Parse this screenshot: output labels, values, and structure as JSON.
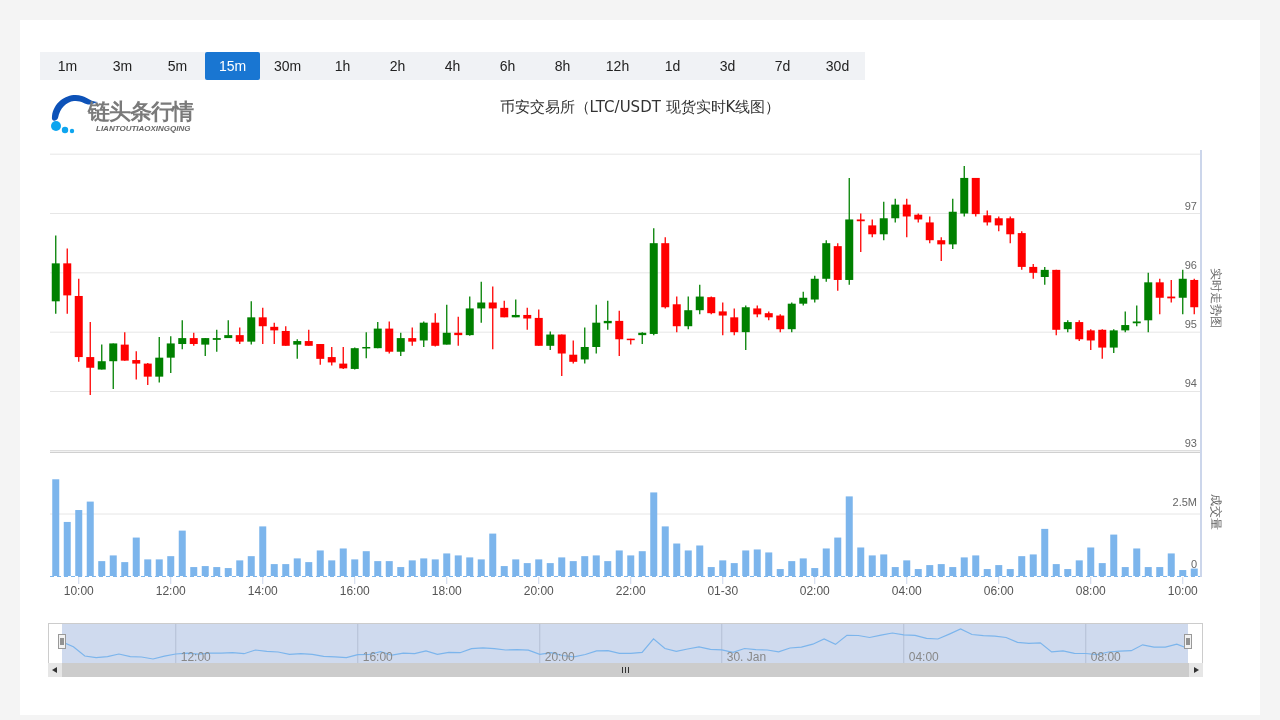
{
  "timeframes": [
    {
      "label": "1m",
      "selected": false
    },
    {
      "label": "3m",
      "selected": false
    },
    {
      "label": "5m",
      "selected": false
    },
    {
      "label": "15m",
      "selected": true
    },
    {
      "label": "30m",
      "selected": false
    },
    {
      "label": "1h",
      "selected": false
    },
    {
      "label": "2h",
      "selected": false
    },
    {
      "label": "4h",
      "selected": false
    },
    {
      "label": "6h",
      "selected": false
    },
    {
      "label": "8h",
      "selected": false
    },
    {
      "label": "12h",
      "selected": false
    },
    {
      "label": "1d",
      "selected": false
    },
    {
      "label": "3d",
      "selected": false
    },
    {
      "label": "7d",
      "selected": false
    },
    {
      "label": "30d",
      "selected": false
    }
  ],
  "logo": {
    "name": "链头条行情",
    "subtitle": "LIANTOUTIAOXINGQING"
  },
  "title": "币安交易所（LTC/USDT 现货实时K线图）",
  "price_panel": {
    "chart_data": {
      "type": "candlestick",
      "ylabel": "实时走势图",
      "ylim": [
        93,
        98
      ],
      "yticks": [
        93,
        94,
        95,
        96,
        97
      ],
      "grid": true,
      "categories": [
        null,
        null,
        null,
        null,
        null,
        null,
        null,
        null,
        null,
        null,
        null,
        null,
        null,
        null,
        null,
        null,
        null,
        null,
        null,
        null,
        null,
        null,
        null,
        null,
        null,
        null,
        null,
        null,
        null,
        null,
        null,
        null,
        null,
        null,
        null,
        null,
        null,
        null,
        null,
        null,
        null,
        null,
        null,
        null,
        null,
        null,
        null,
        null,
        null,
        null,
        null,
        null,
        null,
        null,
        null,
        null,
        null,
        null,
        null,
        null,
        null,
        null,
        null,
        null,
        null,
        null,
        null,
        null,
        null,
        null,
        null,
        null,
        null,
        null,
        null,
        null,
        null,
        null,
        null,
        null,
        null,
        null,
        null,
        null,
        null,
        null,
        null,
        null,
        null,
        null,
        null,
        null,
        null,
        null,
        null,
        null,
        null,
        null,
        null,
        null
      ],
      "ohlc": [
        [
          95.52,
          96.63,
          95.31,
          96.16
        ],
        [
          96.16,
          96.41,
          95.31,
          95.62
        ],
        [
          95.61,
          95.9,
          94.5,
          94.58
        ],
        [
          94.58,
          95.17,
          93.94,
          94.4
        ],
        [
          94.37,
          94.79,
          94.37,
          94.51
        ],
        [
          94.51,
          94.81,
          94.04,
          94.81
        ],
        [
          94.79,
          95.0,
          94.52,
          94.52
        ],
        [
          94.53,
          94.68,
          94.2,
          94.47
        ],
        [
          94.47,
          94.48,
          94.11,
          94.25
        ],
        [
          94.25,
          94.92,
          94.15,
          94.57
        ],
        [
          94.57,
          94.93,
          94.31,
          94.81
        ],
        [
          94.8,
          95.2,
          94.71,
          94.9
        ],
        [
          94.9,
          94.99,
          94.77,
          94.8
        ],
        [
          94.79,
          94.9,
          94.6,
          94.9
        ],
        [
          94.87,
          95.04,
          94.67,
          94.9
        ],
        [
          94.9,
          95.2,
          94.9,
          94.95
        ],
        [
          94.95,
          95.08,
          94.8,
          94.84
        ],
        [
          94.84,
          95.52,
          94.79,
          95.25
        ],
        [
          95.25,
          95.41,
          94.8,
          95.1
        ],
        [
          95.09,
          95.16,
          94.8,
          95.03
        ],
        [
          95.02,
          95.1,
          94.77,
          94.77
        ],
        [
          94.79,
          94.88,
          94.55,
          94.85
        ],
        [
          94.85,
          95.04,
          94.77,
          94.77
        ],
        [
          94.8,
          94.8,
          94.45,
          94.55
        ],
        [
          94.58,
          94.75,
          94.44,
          94.49
        ],
        [
          94.47,
          94.75,
          94.38,
          94.39
        ],
        [
          94.38,
          94.74,
          94.37,
          94.73
        ],
        [
          94.73,
          95.0,
          94.56,
          94.75
        ],
        [
          94.73,
          95.17,
          94.73,
          95.06
        ],
        [
          95.06,
          95.18,
          94.64,
          94.67
        ],
        [
          94.67,
          94.99,
          94.6,
          94.9
        ],
        [
          94.9,
          95.08,
          94.77,
          94.84
        ],
        [
          94.86,
          95.18,
          94.75,
          95.16
        ],
        [
          95.16,
          95.32,
          94.76,
          94.77
        ],
        [
          94.79,
          95.46,
          94.79,
          94.99
        ],
        [
          94.99,
          95.26,
          94.77,
          94.95
        ],
        [
          94.95,
          95.6,
          94.94,
          95.4
        ],
        [
          95.4,
          95.85,
          95.16,
          95.5
        ],
        [
          95.5,
          95.77,
          94.71,
          95.4
        ],
        [
          95.41,
          95.53,
          95.25,
          95.25
        ],
        [
          95.25,
          95.55,
          95.25,
          95.29
        ],
        [
          95.29,
          95.41,
          95.04,
          95.23
        ],
        [
          95.24,
          95.38,
          94.77,
          94.77
        ],
        [
          94.77,
          95.01,
          94.7,
          94.96
        ],
        [
          94.96,
          94.96,
          94.26,
          94.64
        ],
        [
          94.62,
          94.86,
          94.47,
          94.5
        ],
        [
          94.54,
          95.08,
          94.47,
          94.75
        ],
        [
          94.75,
          95.46,
          94.64,
          95.16
        ],
        [
          95.15,
          95.53,
          95.04,
          95.19
        ],
        [
          95.19,
          95.36,
          94.6,
          94.88
        ],
        [
          94.89,
          94.89,
          94.79,
          94.88
        ],
        [
          94.95,
          95.0,
          94.8,
          94.99
        ],
        [
          94.97,
          96.75,
          94.95,
          96.5
        ],
        [
          96.5,
          96.6,
          95.4,
          95.42
        ],
        [
          95.47,
          95.6,
          95.0,
          95.1
        ],
        [
          95.1,
          95.6,
          95.05,
          95.37
        ],
        [
          95.37,
          95.8,
          95.3,
          95.6
        ],
        [
          95.59,
          95.6,
          95.3,
          95.32
        ],
        [
          95.35,
          95.5,
          94.95,
          95.28
        ],
        [
          95.25,
          95.4,
          94.95,
          95.0
        ],
        [
          95.0,
          95.45,
          94.7,
          95.42
        ],
        [
          95.4,
          95.45,
          95.25,
          95.3
        ],
        [
          95.32,
          95.35,
          95.2,
          95.25
        ],
        [
          95.28,
          95.3,
          95.0,
          95.05
        ],
        [
          95.05,
          95.5,
          95.0,
          95.48
        ],
        [
          95.48,
          95.68,
          95.45,
          95.58
        ],
        [
          95.55,
          95.95,
          95.5,
          95.9
        ],
        [
          95.9,
          96.55,
          95.85,
          96.5
        ],
        [
          96.45,
          96.5,
          95.7,
          95.88
        ],
        [
          95.88,
          97.6,
          95.8,
          96.9
        ],
        [
          96.9,
          97.0,
          96.35,
          96.87
        ],
        [
          96.8,
          96.9,
          96.6,
          96.65
        ],
        [
          96.65,
          97.2,
          96.55,
          96.92
        ],
        [
          96.92,
          97.25,
          96.85,
          97.15
        ],
        [
          97.15,
          97.25,
          96.6,
          96.95
        ],
        [
          96.98,
          97.0,
          96.85,
          96.9
        ],
        [
          96.85,
          96.95,
          96.5,
          96.55
        ],
        [
          96.55,
          96.6,
          96.2,
          96.48
        ],
        [
          96.48,
          97.25,
          96.4,
          97.03
        ],
        [
          97.0,
          97.8,
          96.95,
          97.6
        ],
        [
          97.6,
          97.6,
          96.95,
          96.99
        ],
        [
          96.97,
          97.05,
          96.8,
          96.85
        ],
        [
          96.92,
          96.95,
          96.7,
          96.8
        ],
        [
          96.92,
          96.95,
          96.5,
          96.65
        ],
        [
          96.67,
          96.7,
          96.05,
          96.1
        ],
        [
          96.1,
          96.15,
          95.9,
          96.0
        ],
        [
          95.93,
          96.1,
          95.8,
          96.05
        ],
        [
          96.05,
          96.05,
          94.95,
          95.04
        ],
        [
          95.05,
          95.2,
          95.0,
          95.17
        ],
        [
          95.17,
          95.2,
          94.85,
          94.88
        ],
        [
          95.03,
          95.05,
          94.7,
          94.86
        ],
        [
          95.04,
          95.05,
          94.55,
          94.74
        ],
        [
          94.74,
          95.05,
          94.65,
          95.03
        ],
        [
          95.03,
          95.35,
          95.0,
          95.12
        ],
        [
          95.15,
          95.45,
          95.1,
          95.18
        ],
        [
          95.2,
          96.0,
          95.0,
          95.84
        ],
        [
          95.84,
          95.9,
          95.3,
          95.58
        ],
        [
          95.6,
          95.88,
          95.5,
          95.57
        ],
        [
          95.58,
          96.05,
          95.3,
          95.9
        ],
        [
          95.88,
          95.9,
          95.3,
          95.42
        ]
      ]
    }
  },
  "volume_panel": {
    "chart_data": {
      "type": "bar",
      "ylabel": "成交量",
      "ylim": [
        0,
        5
      ],
      "grid": true,
      "categories": [
        null,
        null,
        "10:00",
        null,
        null,
        null,
        null,
        null,
        null,
        null,
        "12:00",
        null,
        null,
        null,
        null,
        null,
        null,
        null,
        "14:00",
        null,
        null,
        null,
        null,
        null,
        null,
        null,
        "16:00",
        null,
        null,
        null,
        null,
        null,
        null,
        null,
        "18:00",
        null,
        null,
        null,
        null,
        null,
        null,
        null,
        "20:00",
        null,
        null,
        null,
        null,
        null,
        null,
        null,
        "22:00",
        null,
        null,
        null,
        null,
        null,
        null,
        null,
        "01-30",
        null,
        null,
        null,
        null,
        null,
        null,
        null,
        "02:00",
        null,
        null,
        null,
        null,
        null,
        null,
        null,
        "04:00",
        null,
        null,
        null,
        null,
        null,
        null,
        null,
        "06:00",
        null,
        null,
        null,
        null,
        null,
        null,
        null,
        "08:00",
        null,
        null,
        null,
        null,
        null,
        null,
        null,
        "10:00",
        null
      ],
      "yticks": [
        0,
        {
          "value": 2.5,
          "label": "2.5M"
        }
      ],
      "values": [
        3.9,
        2.18,
        2.66,
        3.0,
        0.6,
        0.83,
        0.56,
        1.55,
        0.67,
        0.67,
        0.8,
        1.83,
        0.36,
        0.4,
        0.36,
        0.32,
        0.63,
        0.8,
        2.0,
        0.48,
        0.48,
        0.71,
        0.56,
        1.03,
        0.63,
        1.11,
        0.67,
        1.0,
        0.6,
        0.6,
        0.36,
        0.63,
        0.71,
        0.67,
        0.91,
        0.83,
        0.75,
        0.67,
        1.71,
        0.4,
        0.67,
        0.52,
        0.67,
        0.52,
        0.75,
        0.6,
        0.8,
        0.83,
        0.6,
        1.03,
        0.83,
        1.0,
        3.37,
        2.0,
        1.31,
        1.03,
        1.23,
        0.36,
        0.63,
        0.52,
        1.03,
        1.07,
        0.95,
        0.28,
        0.6,
        0.71,
        0.32,
        1.11,
        1.55,
        3.21,
        1.15,
        0.83,
        0.87,
        0.36,
        0.63,
        0.28,
        0.44,
        0.48,
        0.36,
        0.75,
        0.83,
        0.28,
        0.44,
        0.28,
        0.8,
        0.87,
        1.9,
        0.48,
        0.28,
        0.63,
        1.15,
        0.52,
        1.67,
        0.36,
        1.11,
        0.36,
        0.36,
        0.91,
        0.24,
        0.3
      ]
    }
  },
  "navigator": {
    "labels": [
      "12:00",
      "16:00",
      "20:00",
      "30. Jan",
      "04:00",
      "08:00"
    ]
  }
}
